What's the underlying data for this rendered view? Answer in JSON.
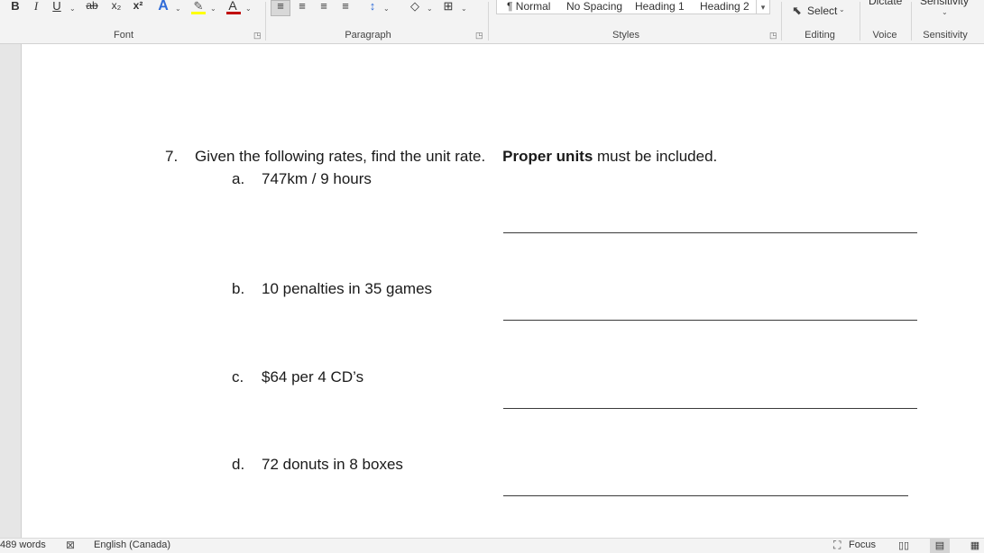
{
  "ribbon": {
    "font": {
      "label": "Font",
      "bold": "B",
      "italic": "I",
      "underline": "U",
      "strikethrough": "ab",
      "subscript": "x₂",
      "superscript": "x²",
      "text_effects": "A",
      "text_color": "A",
      "highlight_color": "#ffff00",
      "font_color": "#c00000"
    },
    "paragraph": {
      "label": "Paragraph"
    },
    "styles": {
      "label": "Styles",
      "items": [
        "¶ Normal",
        "No Spacing",
        "Heading 1",
        "Heading 2"
      ]
    },
    "editing": {
      "label": "Editing",
      "select": "Select"
    },
    "voice": {
      "label": "Voice",
      "dictate": "Dictate"
    },
    "sensitivity": {
      "label": "Sensitivity",
      "button": "Sensitivity"
    }
  },
  "document": {
    "question": {
      "number": "7.",
      "text": "Given the following rates, find the unit rate.",
      "bold": "Proper units",
      "tail": "must be included."
    },
    "items": [
      {
        "letter": "a.",
        "text": "747km / 9 hours"
      },
      {
        "letter": "b.",
        "text": "10 penalties in 35 games"
      },
      {
        "letter": "c.",
        "text": "$64 per 4 CD’s"
      },
      {
        "letter": "d.",
        "text": "72 donuts in 8 boxes"
      }
    ]
  },
  "status": {
    "words": "489 words",
    "language": "English (Canada)",
    "focus": "Focus"
  }
}
